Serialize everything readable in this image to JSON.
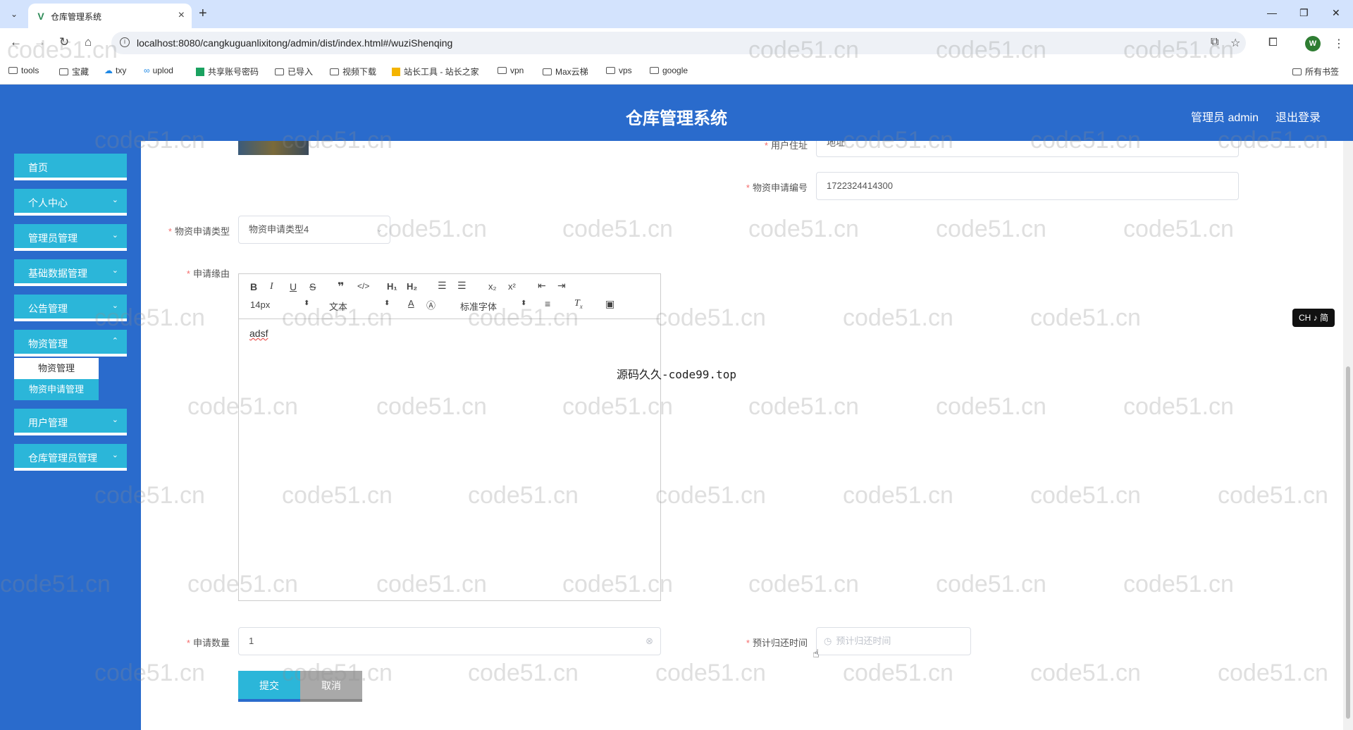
{
  "browser": {
    "tab_title": "仓库管理系统",
    "url": "localhost:8080/cangkuguanlixitong/admin/dist/index.html#/wuziShenqing",
    "bookmarks": [
      "tools",
      "宝藏",
      "txy",
      "uplod",
      "共享账号密码",
      "已导入",
      "视频下载",
      "站长工具 - 站长之家",
      "vpn",
      "Max云梯",
      "vps",
      "google"
    ],
    "all_bookmarks": "所有书签",
    "profile_initial": "W"
  },
  "header": {
    "title": "仓库管理系统",
    "user": "管理员 admin",
    "logout": "退出登录"
  },
  "sidebar": {
    "items": [
      {
        "label": "首页"
      },
      {
        "label": "个人中心"
      },
      {
        "label": "管理员管理"
      },
      {
        "label": "基础数据管理"
      },
      {
        "label": "公告管理"
      },
      {
        "label": "物资管理"
      },
      {
        "label": "用户管理"
      },
      {
        "label": "仓库管理员管理"
      }
    ],
    "submenu": [
      {
        "label": "物资管理"
      },
      {
        "label": "物资申请管理"
      }
    ]
  },
  "form": {
    "address_label": "用户住址",
    "address_value": "地址",
    "apply_no_label": "物资申请编号",
    "apply_no_value": "1722324414300",
    "apply_type_label": "物资申请类型",
    "apply_type_value": "物资申请类型4",
    "reason_label": "申请缘由",
    "reason_value": "adsf",
    "qty_label": "申请数量",
    "qty_value": "1",
    "return_time_label": "预计归还时间",
    "return_time_placeholder": "预计归还时间",
    "submit": "提交",
    "cancel": "取消"
  },
  "editor": {
    "font_size": "14px",
    "text_style": "文本",
    "font_family": "标准字体"
  },
  "watermark": {
    "center_text": "源码久久-code99.top",
    "tile_text": "code51.cn"
  },
  "ime": "CH ♪ 简"
}
